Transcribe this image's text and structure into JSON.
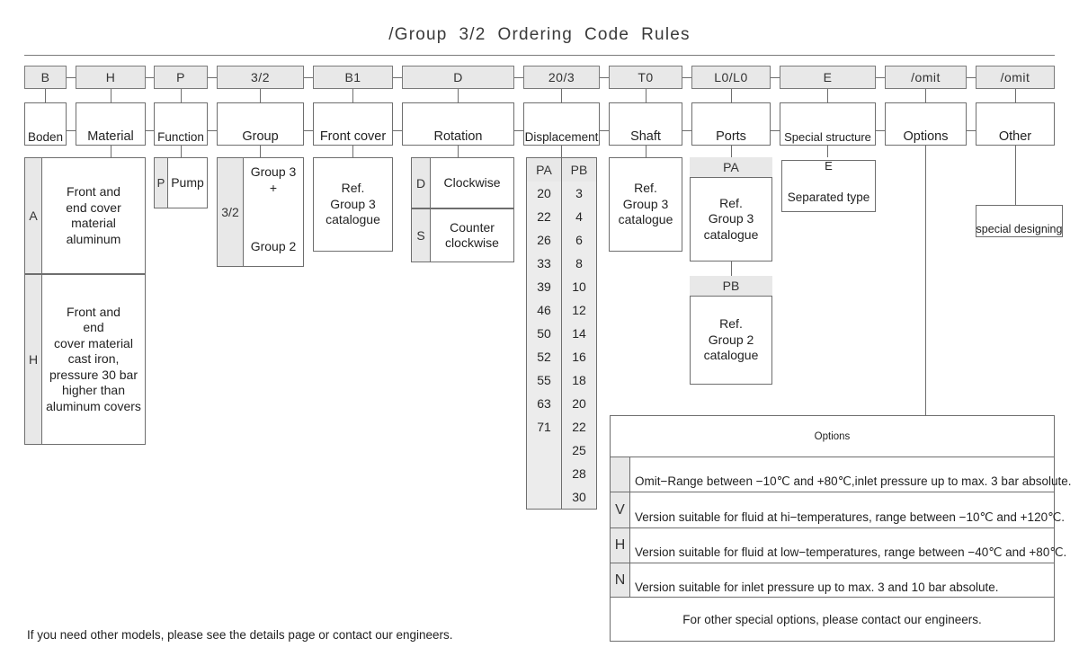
{
  "title": "/Group  3/2  Ordering  Code  Rules",
  "columns": [
    {
      "code": "B",
      "label": "Boden"
    },
    {
      "code": "H",
      "label": "Material"
    },
    {
      "code": "P",
      "label": "Function"
    },
    {
      "code": "3/2",
      "label": "Group"
    },
    {
      "code": "B1",
      "label": "Front  cover"
    },
    {
      "code": "D",
      "label": "Rotation"
    },
    {
      "code": "20/3",
      "label": "Displacement"
    },
    {
      "code": "T0",
      "label": "Shaft"
    },
    {
      "code": "L0/L0",
      "label": "Ports"
    },
    {
      "code": "E",
      "label": "Special structure"
    },
    {
      "code": "/omit",
      "label": "Options"
    },
    {
      "code": "/omit",
      "label": "Other"
    }
  ],
  "material": {
    "rows": [
      {
        "code": "A",
        "text": "Front  and\nend  cover\nmaterial\naluminum"
      },
      {
        "code": "H",
        "text": "Front  and\nend\ncover material\ncast  iron,\npressure  30  bar\nhigher  than\naluminum  covers"
      }
    ]
  },
  "function": {
    "rows": [
      {
        "code": "P",
        "text": "Pump"
      }
    ]
  },
  "group": {
    "code": "3/2",
    "top_text": "Group  3\n+",
    "bottom_text": "Group  2"
  },
  "front_cover": {
    "text": "Ref.\nGroup  3\ncatalogue"
  },
  "rotation": {
    "rows": [
      {
        "code": "D",
        "text": "Clockwise"
      },
      {
        "code": "S",
        "text": "Counter\nclockwise"
      }
    ]
  },
  "displacement": {
    "headers": [
      "PA",
      "PB"
    ],
    "pa": [
      "20",
      "22",
      "26",
      "33",
      "39",
      "46",
      "50",
      "52",
      "55",
      "63",
      "71",
      "",
      "",
      ""
    ],
    "pb": [
      "3",
      "4",
      "6",
      "8",
      "10",
      "12",
      "14",
      "16",
      "18",
      "20",
      "22",
      "25",
      "28",
      "30"
    ]
  },
  "shaft": {
    "text": "Ref.\nGroup  3\ncatalogue"
  },
  "ports": {
    "blocks": [
      {
        "header": "PA",
        "text": "Ref.\nGroup  3\ncatalogue"
      },
      {
        "header": "PB",
        "text": "Ref.\nGroup  2\ncatalogue"
      }
    ]
  },
  "special_structure": {
    "code": "E",
    "text": "Separated  type"
  },
  "other": {
    "text": "special  designing"
  },
  "options_table": {
    "title": "Options",
    "rows": [
      {
        "code": "",
        "text": "Omit−Range  between  −10℃  and  +80℃,inlet  pressure  up  to  max.  3  bar  absolute."
      },
      {
        "code": "V",
        "text": "Version  suitable  for  fluid  at  hi−temperatures,  range  between  −10℃  and  +120℃."
      },
      {
        "code": "H",
        "text": "Version  suitable  for  fluid  at  low−temperatures,  range  between  −40℃  and  +80℃."
      },
      {
        "code": "N",
        "text": "Version  suitable  for  inlet  pressure  up  to  max.  3  and  10  bar  absolute."
      }
    ],
    "footer": "For  other  special  options,  please  contact  our  engineers."
  },
  "footnote": "If  you  need  other  models,  please  see  the  details  page  or  contact  our  engineers."
}
